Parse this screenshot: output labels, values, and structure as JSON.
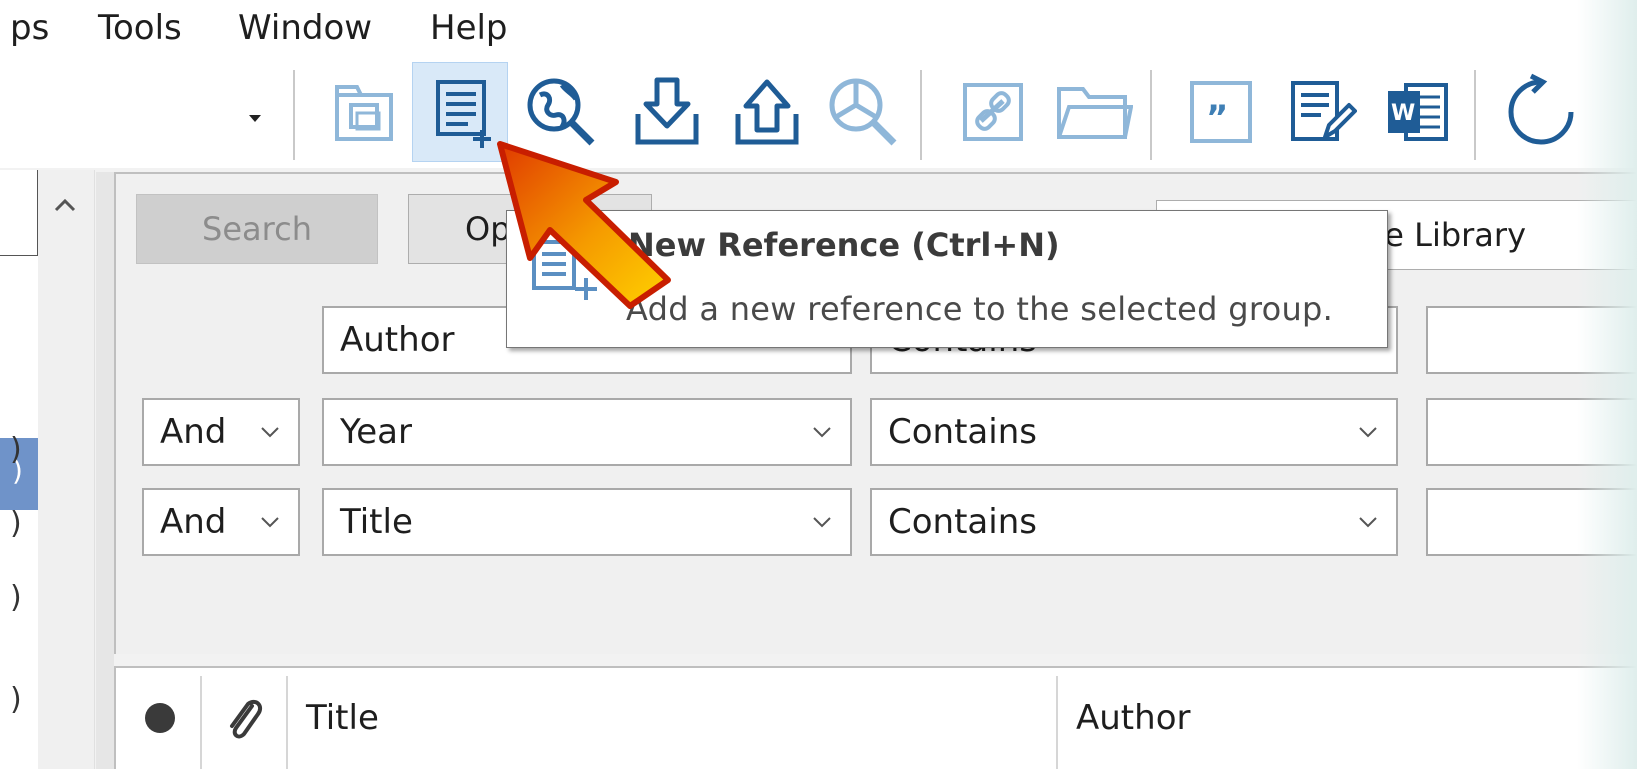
{
  "menubar": {
    "items": [
      "ps",
      "Tools",
      "Window",
      "Help"
    ]
  },
  "toolbar": {
    "buttons": [
      {
        "name": "copy-to-library"
      },
      {
        "name": "new-reference",
        "active": true
      },
      {
        "name": "online-search"
      },
      {
        "name": "import"
      },
      {
        "name": "export"
      },
      {
        "name": "find-full-text"
      },
      {
        "name": "open-link"
      },
      {
        "name": "open-file"
      },
      {
        "name": "insert-citation"
      },
      {
        "name": "format-bibliography"
      },
      {
        "name": "return-to-word"
      },
      {
        "name": "sync"
      }
    ]
  },
  "search": {
    "search_label": "Search",
    "options_label": "Op",
    "library_label": "e Library",
    "rows": [
      {
        "bool": "",
        "field": "Author",
        "condition": "Contains"
      },
      {
        "bool": "And",
        "field": "Year",
        "condition": "Contains"
      },
      {
        "bool": "And",
        "field": "Title",
        "condition": "Contains"
      }
    ]
  },
  "tooltip": {
    "title": "New Reference (Ctrl+N)",
    "description": "Add a new reference to the selected group."
  },
  "results": {
    "columns": [
      "Title",
      "Author"
    ]
  },
  "left_panel": {
    "paren_marks": [
      ")",
      ")",
      ")",
      ")"
    ]
  },
  "colors": {
    "accent": "#1f6fb2",
    "active_button": "#d9e9f8",
    "selection": "#6f93c9",
    "callout_arrow": "#f08a00"
  }
}
